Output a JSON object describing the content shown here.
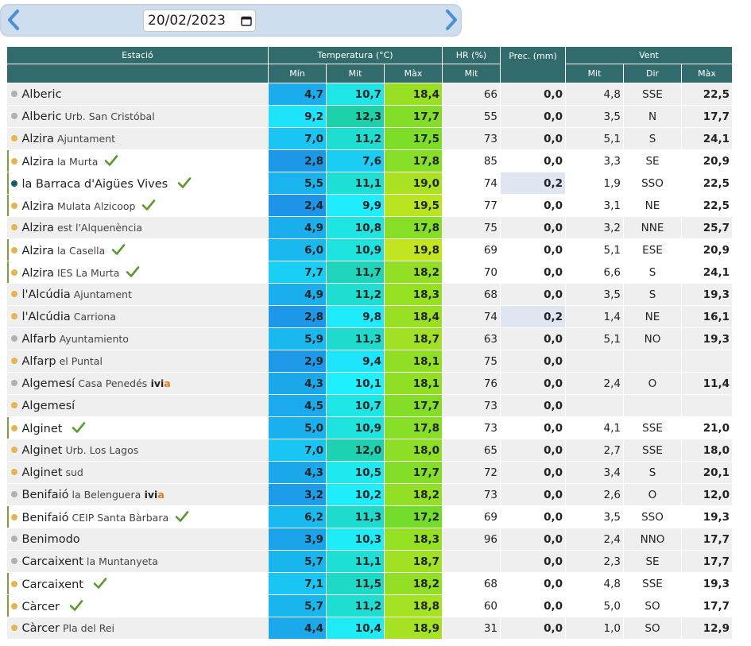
{
  "date_nav": {
    "date_value": "20/02/2023",
    "prev_icon": "chevron-left-icon",
    "next_icon": "chevron-right-icon",
    "calendar_icon": "calendar-icon"
  },
  "table": {
    "headers": {
      "station": "Estació",
      "temperature": "Temperatura (°C)",
      "humidity": "HR (%)",
      "precipitation": "Prec. (mm)",
      "wind": "Vent",
      "temp_min": "Mín",
      "temp_avg": "Mit",
      "temp_max": "Màx",
      "hr_avg": "Mit",
      "wind_avg": "Mit",
      "wind_dir": "Dir",
      "wind_max": "Màx"
    },
    "rows": [
      {
        "name": "Alberic",
        "sub": "",
        "tag": "",
        "tag_tail": "",
        "check": false,
        "dot": "#b0b0b0",
        "min": "4,7",
        "avg": "10,7",
        "max": "18,4",
        "hr": "66",
        "prec": "0,0",
        "wavg": "4,8",
        "wdir": "SSE",
        "wmax": "22,5"
      },
      {
        "name": "Alberic",
        "sub": "Urb. San Cristóbal",
        "tag": "",
        "tag_tail": "",
        "check": false,
        "dot": "#b0b0b0",
        "min": "9,2",
        "avg": "12,3",
        "max": "17,7",
        "hr": "55",
        "prec": "0,0",
        "wavg": "3,5",
        "wdir": "N",
        "wmax": "17,7"
      },
      {
        "name": "Alzira",
        "sub": "Ajuntament",
        "tag": "",
        "tag_tail": "",
        "check": false,
        "dot": "#e8b450",
        "min": "7,0",
        "avg": "11,2",
        "max": "17,5",
        "hr": "73",
        "prec": "0,0",
        "wavg": "5,1",
        "wdir": "S",
        "wmax": "24,1"
      },
      {
        "name": "Alzira",
        "sub": "la Murta",
        "tag": "",
        "tag_tail": "",
        "check": true,
        "dot": "#e8b450",
        "min": "2,8",
        "avg": "7,6",
        "max": "17,8",
        "hr": "85",
        "prec": "0,0",
        "wavg": "3,3",
        "wdir": "SE",
        "wmax": "20,9"
      },
      {
        "name": "la Barraca d'Aigües Vives",
        "sub": "",
        "tag": "",
        "tag_tail": "",
        "check": true,
        "dot": "#126060",
        "min": "5,5",
        "avg": "11,1",
        "max": "19,0",
        "hr": "74",
        "prec": "0,2",
        "wavg": "1,9",
        "wdir": "SSO",
        "wmax": "22,5"
      },
      {
        "name": "Alzira",
        "sub": "Mulata Alzicoop",
        "tag": "",
        "tag_tail": "",
        "check": true,
        "dot": "#e8b450",
        "min": "2,4",
        "avg": "9,9",
        "max": "19,5",
        "hr": "77",
        "prec": "0,0",
        "wavg": "3,1",
        "wdir": "NE",
        "wmax": "22,5"
      },
      {
        "name": "Alzira",
        "sub": "est l'Alquenència",
        "tag": "",
        "tag_tail": "",
        "check": false,
        "dot": "#e8b450",
        "min": "4,9",
        "avg": "10,8",
        "max": "17,8",
        "hr": "75",
        "prec": "0,0",
        "wavg": "3,2",
        "wdir": "NNE",
        "wmax": "25,7"
      },
      {
        "name": "Alzira",
        "sub": "la Casella",
        "tag": "",
        "tag_tail": "",
        "check": true,
        "dot": "#e8b450",
        "min": "6,0",
        "avg": "10,9",
        "max": "19,8",
        "hr": "69",
        "prec": "0,0",
        "wavg": "5,1",
        "wdir": "ESE",
        "wmax": "20,9"
      },
      {
        "name": "Alzira",
        "sub": "IES La Murta",
        "tag": "",
        "tag_tail": "",
        "check": true,
        "dot": "#e8b450",
        "min": "7,7",
        "avg": "11,7",
        "max": "18,2",
        "hr": "70",
        "prec": "0,0",
        "wavg": "6,6",
        "wdir": "S",
        "wmax": "24,1"
      },
      {
        "name": "l'Alcúdia",
        "sub": "Ajuntament",
        "tag": "",
        "tag_tail": "",
        "check": false,
        "dot": "#e8b450",
        "min": "4,9",
        "avg": "11,2",
        "max": "18,3",
        "hr": "68",
        "prec": "0,0",
        "wavg": "3,5",
        "wdir": "S",
        "wmax": "19,3"
      },
      {
        "name": "l'Alcúdia",
        "sub": "Carriona",
        "tag": "",
        "tag_tail": "",
        "check": false,
        "dot": "#e8b450",
        "min": "2,8",
        "avg": "9,8",
        "max": "18,4",
        "hr": "74",
        "prec": "0,2",
        "wavg": "1,4",
        "wdir": "NE",
        "wmax": "16,1"
      },
      {
        "name": "Alfarb",
        "sub": "Ayuntamiento",
        "tag": "",
        "tag_tail": "",
        "check": false,
        "dot": "#b0b0b0",
        "min": "5,9",
        "avg": "11,3",
        "max": "18,7",
        "hr": "63",
        "prec": "0,0",
        "wavg": "5,1",
        "wdir": "NO",
        "wmax": "19,3"
      },
      {
        "name": "Alfarp",
        "sub": "el Puntal",
        "tag": "",
        "tag_tail": "",
        "check": false,
        "dot": "#e8b450",
        "min": "2,9",
        "avg": "9,4",
        "max": "18,1",
        "hr": "75",
        "prec": "0,0",
        "wavg": "",
        "wdir": "",
        "wmax": ""
      },
      {
        "name": "Algemesí",
        "sub": "Casa Penedés",
        "tag": "ivi",
        "tag_tail": "a",
        "check": false,
        "dot": "#b0b0b0",
        "min": "4,3",
        "avg": "10,1",
        "max": "18,1",
        "hr": "76",
        "prec": "0,0",
        "wavg": "2,4",
        "wdir": "O",
        "wmax": "11,4"
      },
      {
        "name": "Algemesí",
        "sub": "",
        "tag": "",
        "tag_tail": "",
        "check": false,
        "dot": "#e8b450",
        "min": "4,5",
        "avg": "10,7",
        "max": "17,7",
        "hr": "73",
        "prec": "0,0",
        "wavg": "",
        "wdir": "",
        "wmax": ""
      },
      {
        "name": "Alginet",
        "sub": "",
        "tag": "",
        "tag_tail": "",
        "check": true,
        "dot": "#e8b450",
        "min": "5,0",
        "avg": "10,9",
        "max": "17,8",
        "hr": "73",
        "prec": "0,0",
        "wavg": "4,1",
        "wdir": "SSE",
        "wmax": "21,0"
      },
      {
        "name": "Alginet",
        "sub": "Urb. Los Lagos",
        "tag": "",
        "tag_tail": "",
        "check": false,
        "dot": "#e8b450",
        "min": "7,0",
        "avg": "12,0",
        "max": "18,0",
        "hr": "65",
        "prec": "0,0",
        "wavg": "2,7",
        "wdir": "SSE",
        "wmax": "18,0"
      },
      {
        "name": "Alginet",
        "sub": "sud",
        "tag": "",
        "tag_tail": "",
        "check": false,
        "dot": "#e8b450",
        "min": "4,3",
        "avg": "10,5",
        "max": "17,7",
        "hr": "72",
        "prec": "0,0",
        "wavg": "3,4",
        "wdir": "S",
        "wmax": "20,1"
      },
      {
        "name": "Benifaió",
        "sub": "la Belenguera",
        "tag": "ivi",
        "tag_tail": "a",
        "check": false,
        "dot": "#b0b0b0",
        "min": "3,2",
        "avg": "10,2",
        "max": "18,2",
        "hr": "73",
        "prec": "0,0",
        "wavg": "2,6",
        "wdir": "O",
        "wmax": "12,0"
      },
      {
        "name": "Benifaió",
        "sub": "CEIP Santa Bàrbara",
        "tag": "",
        "tag_tail": "",
        "check": true,
        "dot": "#e8b450",
        "min": "6,2",
        "avg": "11,3",
        "max": "17,2",
        "hr": "69",
        "prec": "0,0",
        "wavg": "3,5",
        "wdir": "SSO",
        "wmax": "19,3"
      },
      {
        "name": "Benimodo",
        "sub": "",
        "tag": "",
        "tag_tail": "",
        "check": false,
        "dot": "#b0b0b0",
        "min": "3,9",
        "avg": "10,3",
        "max": "18,3",
        "hr": "96",
        "prec": "0,0",
        "wavg": "2,4",
        "wdir": "NNO",
        "wmax": "17,7"
      },
      {
        "name": "Carcaixent",
        "sub": "la Muntanyeta",
        "tag": "",
        "tag_tail": "",
        "check": false,
        "dot": "#b0b0b0",
        "min": "5,7",
        "avg": "11,1",
        "max": "18,7",
        "hr": "",
        "prec": "0,0",
        "wavg": "2,3",
        "wdir": "SE",
        "wmax": "17,7"
      },
      {
        "name": "Carcaixent",
        "sub": "",
        "tag": "",
        "tag_tail": "",
        "check": true,
        "dot": "#e8b450",
        "min": "7,1",
        "avg": "11,5",
        "max": "18,2",
        "hr": "68",
        "prec": "0,0",
        "wavg": "4,8",
        "wdir": "SSE",
        "wmax": "19,3"
      },
      {
        "name": "Càrcer",
        "sub": "",
        "tag": "",
        "tag_tail": "",
        "check": true,
        "dot": "#e8b450",
        "min": "5,7",
        "avg": "11,2",
        "max": "18,8",
        "hr": "60",
        "prec": "0,0",
        "wavg": "5,0",
        "wdir": "SO",
        "wmax": "17,7"
      },
      {
        "name": "Càrcer",
        "sub": "Pla del Rei",
        "tag": "",
        "tag_tail": "",
        "check": false,
        "dot": "#e8b450",
        "min": "4,4",
        "avg": "10,4",
        "max": "18,9",
        "hr": "31",
        "prec": "0,0",
        "wavg": "1,0",
        "wdir": "SO",
        "wmax": "12,9"
      }
    ]
  }
}
